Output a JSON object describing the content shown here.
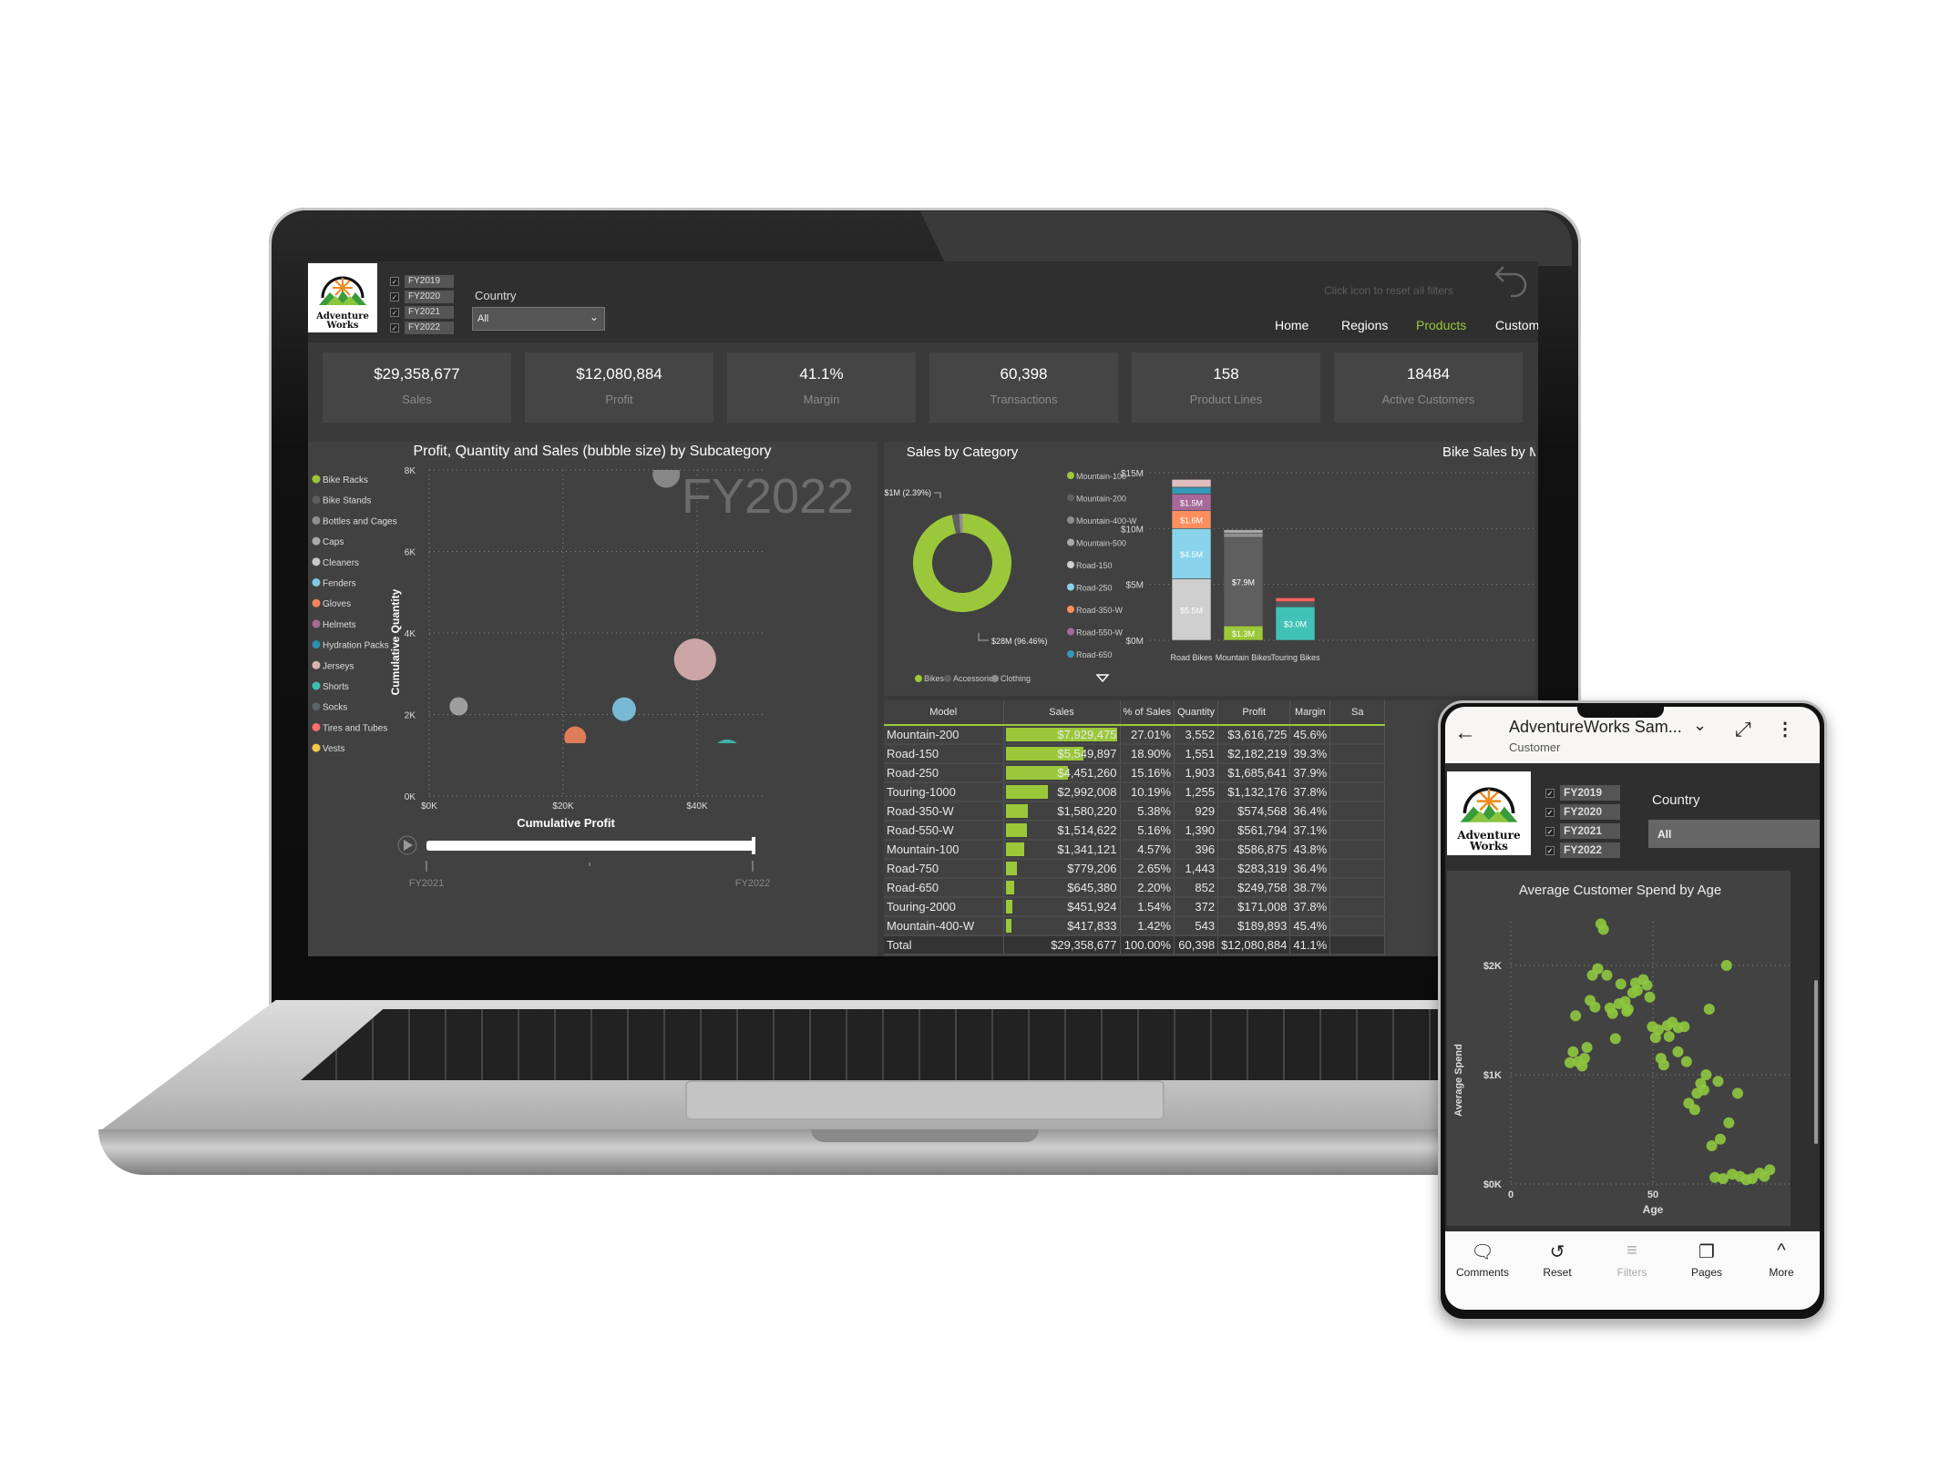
{
  "dashboard": {
    "logo_text": [
      "Adventure",
      "Works"
    ],
    "fiscal_years": [
      {
        "label": "FY2019",
        "checked": true
      },
      {
        "label": "FY2020",
        "checked": true
      },
      {
        "label": "FY2021",
        "checked": true
      },
      {
        "label": "FY2022",
        "checked": true
      }
    ],
    "country_label": "Country",
    "country_value": "All",
    "reset_hint": "Click icon to reset all filters",
    "nav": [
      {
        "label": "Home",
        "active": false
      },
      {
        "label": "Regions",
        "active": false
      },
      {
        "label": "Products",
        "active": true
      },
      {
        "label": "Customers",
        "active": false
      }
    ],
    "accent_color": "#9bc83a",
    "kpis": [
      {
        "value": "$29,358,677",
        "label": "Sales"
      },
      {
        "value": "$12,080,884",
        "label": "Profit"
      },
      {
        "value": "41.1%",
        "label": "Margin"
      },
      {
        "value": "60,398",
        "label": "Transactions"
      },
      {
        "value": "158",
        "label": "Product Lines"
      },
      {
        "value": "18484",
        "label": "Active Customers"
      }
    ],
    "table": {
      "columns": [
        "Model",
        "Sales",
        "% of Sales",
        "Quantity",
        "Profit",
        "Margin",
        "Sa"
      ],
      "rows": [
        {
          "model": "Mountain-200",
          "sales": "$7,929,475",
          "sales_value": 7929475,
          "pct": "27.01%",
          "qty": "3,552",
          "profit": "$3,616,725",
          "margin": "45.6%"
        },
        {
          "model": "Road-150",
          "sales": "$5,549,897",
          "sales_value": 5549897,
          "pct": "18.90%",
          "qty": "1,551",
          "profit": "$2,182,219",
          "margin": "39.3%"
        },
        {
          "model": "Road-250",
          "sales": "$4,451,260",
          "sales_value": 4451260,
          "pct": "15.16%",
          "qty": "1,903",
          "profit": "$1,685,641",
          "margin": "37.9%"
        },
        {
          "model": "Touring-1000",
          "sales": "$2,992,008",
          "sales_value": 2992008,
          "pct": "10.19%",
          "qty": "1,255",
          "profit": "$1,132,176",
          "margin": "37.8%"
        },
        {
          "model": "Road-350-W",
          "sales": "$1,580,220",
          "sales_value": 1580220,
          "pct": "5.38%",
          "qty": "929",
          "profit": "$574,568",
          "margin": "36.4%"
        },
        {
          "model": "Road-550-W",
          "sales": "$1,514,622",
          "sales_value": 1514622,
          "pct": "5.16%",
          "qty": "1,390",
          "profit": "$561,794",
          "margin": "37.1%"
        },
        {
          "model": "Mountain-100",
          "sales": "$1,341,121",
          "sales_value": 1341121,
          "pct": "4.57%",
          "qty": "396",
          "profit": "$586,875",
          "margin": "43.8%"
        },
        {
          "model": "Road-750",
          "sales": "$779,206",
          "sales_value": 779206,
          "pct": "2.65%",
          "qty": "1,443",
          "profit": "$283,319",
          "margin": "36.4%"
        },
        {
          "model": "Road-650",
          "sales": "$645,380",
          "sales_value": 645380,
          "pct": "2.20%",
          "qty": "852",
          "profit": "$249,758",
          "margin": "38.7%"
        },
        {
          "model": "Touring-2000",
          "sales": "$451,924",
          "sales_value": 451924,
          "pct": "1.54%",
          "qty": "372",
          "profit": "$171,008",
          "margin": "37.8%"
        },
        {
          "model": "Mountain-400-W",
          "sales": "$417,833",
          "sales_value": 417833,
          "pct": "1.42%",
          "qty": "543",
          "profit": "$189,893",
          "margin": "45.4%"
        }
      ],
      "total": {
        "model": "Total",
        "sales": "$29,358,677",
        "pct": "100.00%",
        "qty": "60,398",
        "profit": "$12,080,884",
        "margin": "41.1%"
      }
    }
  },
  "phone": {
    "title": "AdventureWorks Sam...",
    "subtitle": "Customer",
    "country_label": "Country",
    "country_value": "All",
    "fiscal_years": [
      "FY2019",
      "FY2020",
      "FY2021",
      "FY2022"
    ],
    "bottom_nav": [
      {
        "label": "Comments",
        "icon": "comment-icon",
        "enabled": true
      },
      {
        "label": "Reset",
        "icon": "reset-icon",
        "enabled": true
      },
      {
        "label": "Filters",
        "icon": "filter-icon",
        "enabled": false
      },
      {
        "label": "Pages",
        "icon": "pages-icon",
        "enabled": true
      },
      {
        "label": "More",
        "icon": "chevron-up-icon",
        "enabled": true
      }
    ]
  },
  "chart_data": [
    {
      "type": "scatter",
      "title": "Profit, Quantity and Sales (bubble size) by Subcategory",
      "xlabel": "Cumulative Profit",
      "ylabel": "Cumulative Quantity",
      "xticks": [
        "$0K",
        "$20K",
        "$40K"
      ],
      "yticks": [
        "0K",
        "2K",
        "4K",
        "6K",
        "8K"
      ],
      "xlim": [
        0,
        50000
      ],
      "ylim": [
        0,
        8000
      ],
      "grid": true,
      "legend_position": "left",
      "play_axis": {
        "watermark": "FY2022",
        "start": "FY2021",
        "end": "FY2022",
        "position": 1.0
      },
      "legend": [
        {
          "name": "Bike Racks",
          "color": "#9bc83a"
        },
        {
          "name": "Bike Stands",
          "color": "#5f5f5f"
        },
        {
          "name": "Bottles and Cages",
          "color": "#8f8f8f"
        },
        {
          "name": "Caps",
          "color": "#a9a9a9"
        },
        {
          "name": "Cleaners",
          "color": "#c8c8c8"
        },
        {
          "name": "Fenders",
          "color": "#7ec8e3"
        },
        {
          "name": "Gloves",
          "color": "#f0845a"
        },
        {
          "name": "Helmets",
          "color": "#a66999"
        },
        {
          "name": "Hydration Packs",
          "color": "#2e8fb0"
        },
        {
          "name": "Jerseys",
          "color": "#dcb1b3"
        },
        {
          "name": "Shorts",
          "color": "#3fbfb0"
        },
        {
          "name": "Socks",
          "color": "#5a6366"
        },
        {
          "name": "Tires and Tubes",
          "color": "#fd6e6a"
        },
        {
          "name": "Vests",
          "color": "#f2c94c"
        }
      ],
      "points": [
        {
          "name": "Bottles and Cages",
          "x": 35400,
          "y": 7900,
          "size": 15
        },
        {
          "name": "Jerseys",
          "x": 39700,
          "y": 3350,
          "size": 23
        },
        {
          "name": "Fenders",
          "x": 29100,
          "y": 2130,
          "size": 13
        },
        {
          "name": "Shorts",
          "x": 44500,
          "y": 1030,
          "size": 16
        },
        {
          "name": "Gloves",
          "x": 21800,
          "y": 1440,
          "size": 12
        },
        {
          "name": "Hydration Packs",
          "x": 25100,
          "y": 740,
          "size": 12
        },
        {
          "name": "Bike Stands",
          "x": 24700,
          "y": 280,
          "size": 12
        },
        {
          "name": "Bike Racks",
          "x": 24600,
          "y": 330,
          "size": 12
        },
        {
          "name": "Vests",
          "x": 22200,
          "y": 570,
          "size": 12
        },
        {
          "name": "Caps",
          "x": 4400,
          "y": 2200,
          "size": 10
        },
        {
          "name": "Cleaners",
          "x": 4400,
          "y": 920,
          "size": 8
        },
        {
          "name": "Socks",
          "x": 3100,
          "y": 570,
          "size": 7.5
        }
      ]
    },
    {
      "type": "pie",
      "title": "Sales by Category",
      "legend_position": "bottom",
      "slices": [
        {
          "name": "Bikes",
          "value": 96.46,
          "label": "$28M (96.46%)",
          "color": "#9bc83a"
        },
        {
          "name": "Accessories",
          "value": 2.39,
          "label": "$1M (2.39%)",
          "color": "#5f5f5f"
        },
        {
          "name": "Clothing",
          "value": 1.15,
          "color": "#8f8f8f"
        }
      ]
    },
    {
      "type": "bar",
      "stacked": true,
      "title": "Bike Sales by Model",
      "categories": [
        "Road Bikes",
        "Mountain Bikes",
        "Touring Bikes"
      ],
      "yticks": [
        "$0M",
        "$5M",
        "$10M",
        "$15M"
      ],
      "ylim": [
        0,
        15
      ],
      "grid": true,
      "legend_position": "left",
      "legend": [
        {
          "name": "Mountain-100",
          "color": "#9bc83a"
        },
        {
          "name": "Mountain-200",
          "color": "#5f5f5f"
        },
        {
          "name": "Mountain-400-W",
          "color": "#8f8f8f"
        },
        {
          "name": "Mountain-500",
          "color": "#a9a9a9"
        },
        {
          "name": "Road-150",
          "color": "#cfcfcf"
        },
        {
          "name": "Road-250",
          "color": "#8ad4eb"
        },
        {
          "name": "Road-350-W",
          "color": "#fd8f5f"
        },
        {
          "name": "Road-550-W",
          "color": "#a66999"
        },
        {
          "name": "Road-650",
          "color": "#3599b8"
        }
      ],
      "stacks": [
        [
          {
            "name": "Road-150",
            "value": 5.5,
            "label": "$5.5M",
            "color": "#cfcfcf"
          },
          {
            "name": "Road-250",
            "value": 4.5,
            "label": "$4.5M",
            "color": "#8ad4eb"
          },
          {
            "name": "Road-350-W",
            "value": 1.6,
            "label": "$1.6M",
            "color": "#fd8f5f"
          },
          {
            "name": "Road-550-W",
            "value": 1.5,
            "label": "$1.5M",
            "color": "#a66999"
          },
          {
            "name": "Road-650",
            "value": 0.6,
            "color": "#3599b8"
          },
          {
            "name": "Road-750",
            "value": 0.7,
            "color": "#dfbfbf"
          }
        ],
        [
          {
            "name": "Mountain-100",
            "value": 1.3,
            "label": "$1.3M",
            "color": "#9bc83a"
          },
          {
            "name": "Mountain-200",
            "value": 7.9,
            "label": "$7.9M",
            "color": "#5f5f5f"
          },
          {
            "name": "Mountain-400-W",
            "value": 0.4,
            "color": "#8f8f8f"
          },
          {
            "name": "Mountain-500",
            "value": 0.3,
            "color": "#a9a9a9"
          }
        ],
        [
          {
            "name": "Touring-1000",
            "value": 3.0,
            "label": "$3.0M",
            "color": "#42c2b6"
          },
          {
            "name": "Touring-2000",
            "value": 0.45,
            "color": "#4e5a5c"
          },
          {
            "name": "Touring-3000",
            "value": 0.35,
            "color": "#fd625e"
          }
        ]
      ]
    },
    {
      "type": "scatter",
      "title": "Average Customer Spend by Age",
      "xlabel": "Age",
      "ylabel": "Average Spend",
      "xticks": [
        "0",
        "50",
        "1"
      ],
      "yticks": [
        "$0K",
        "$1K",
        "$2K"
      ],
      "xlim": [
        0,
        100
      ],
      "ylim": [
        0,
        2400
      ],
      "grid": true,
      "color": "#8dc63f",
      "points": [
        [
          31.7,
          2380
        ],
        [
          32.6,
          2330
        ],
        [
          30.6,
          1970
        ],
        [
          28.7,
          1910
        ],
        [
          33.8,
          1910
        ],
        [
          38.7,
          1830
        ],
        [
          43.9,
          1840
        ],
        [
          46.6,
          1870
        ],
        [
          47.9,
          1820
        ],
        [
          42.9,
          1750
        ],
        [
          44.5,
          1770
        ],
        [
          48.9,
          1710
        ],
        [
          27.9,
          1680
        ],
        [
          29.6,
          1620
        ],
        [
          34.9,
          1610
        ],
        [
          38.1,
          1650
        ],
        [
          40.2,
          1670
        ],
        [
          41.3,
          1600
        ],
        [
          35.8,
          1560
        ],
        [
          40.8,
          1580
        ],
        [
          22.8,
          1540
        ],
        [
          69.8,
          1600
        ],
        [
          75.9,
          2000
        ],
        [
          49.8,
          1440
        ],
        [
          51.9,
          1410
        ],
        [
          55.1,
          1450
        ],
        [
          56.8,
          1480
        ],
        [
          58.9,
          1430
        ],
        [
          61.0,
          1440
        ],
        [
          50.9,
          1340
        ],
        [
          55.7,
          1350
        ],
        [
          36.8,
          1330
        ],
        [
          21.9,
          1210
        ],
        [
          26.8,
          1250
        ],
        [
          25.9,
          1150
        ],
        [
          20.8,
          1110
        ],
        [
          23.7,
          1120
        ],
        [
          25.1,
          1080
        ],
        [
          58.8,
          1210
        ],
        [
          61.8,
          1120
        ],
        [
          52.8,
          1150
        ],
        [
          53.8,
          1090
        ],
        [
          68.7,
          1000
        ],
        [
          72.9,
          940
        ],
        [
          66.8,
          920
        ],
        [
          67.9,
          860
        ],
        [
          65.5,
          830
        ],
        [
          79.8,
          830
        ],
        [
          62.6,
          740
        ],
        [
          64.7,
          680
        ],
        [
          76.7,
          560
        ],
        [
          73.7,
          410
        ],
        [
          70.7,
          350
        ],
        [
          71.8,
          60
        ],
        [
          74.7,
          50
        ],
        [
          77.9,
          90
        ],
        [
          80.6,
          70
        ],
        [
          82.8,
          40
        ],
        [
          84.9,
          50
        ],
        [
          87.6,
          100
        ],
        [
          89.2,
          70
        ],
        [
          91.1,
          130
        ]
      ]
    }
  ]
}
